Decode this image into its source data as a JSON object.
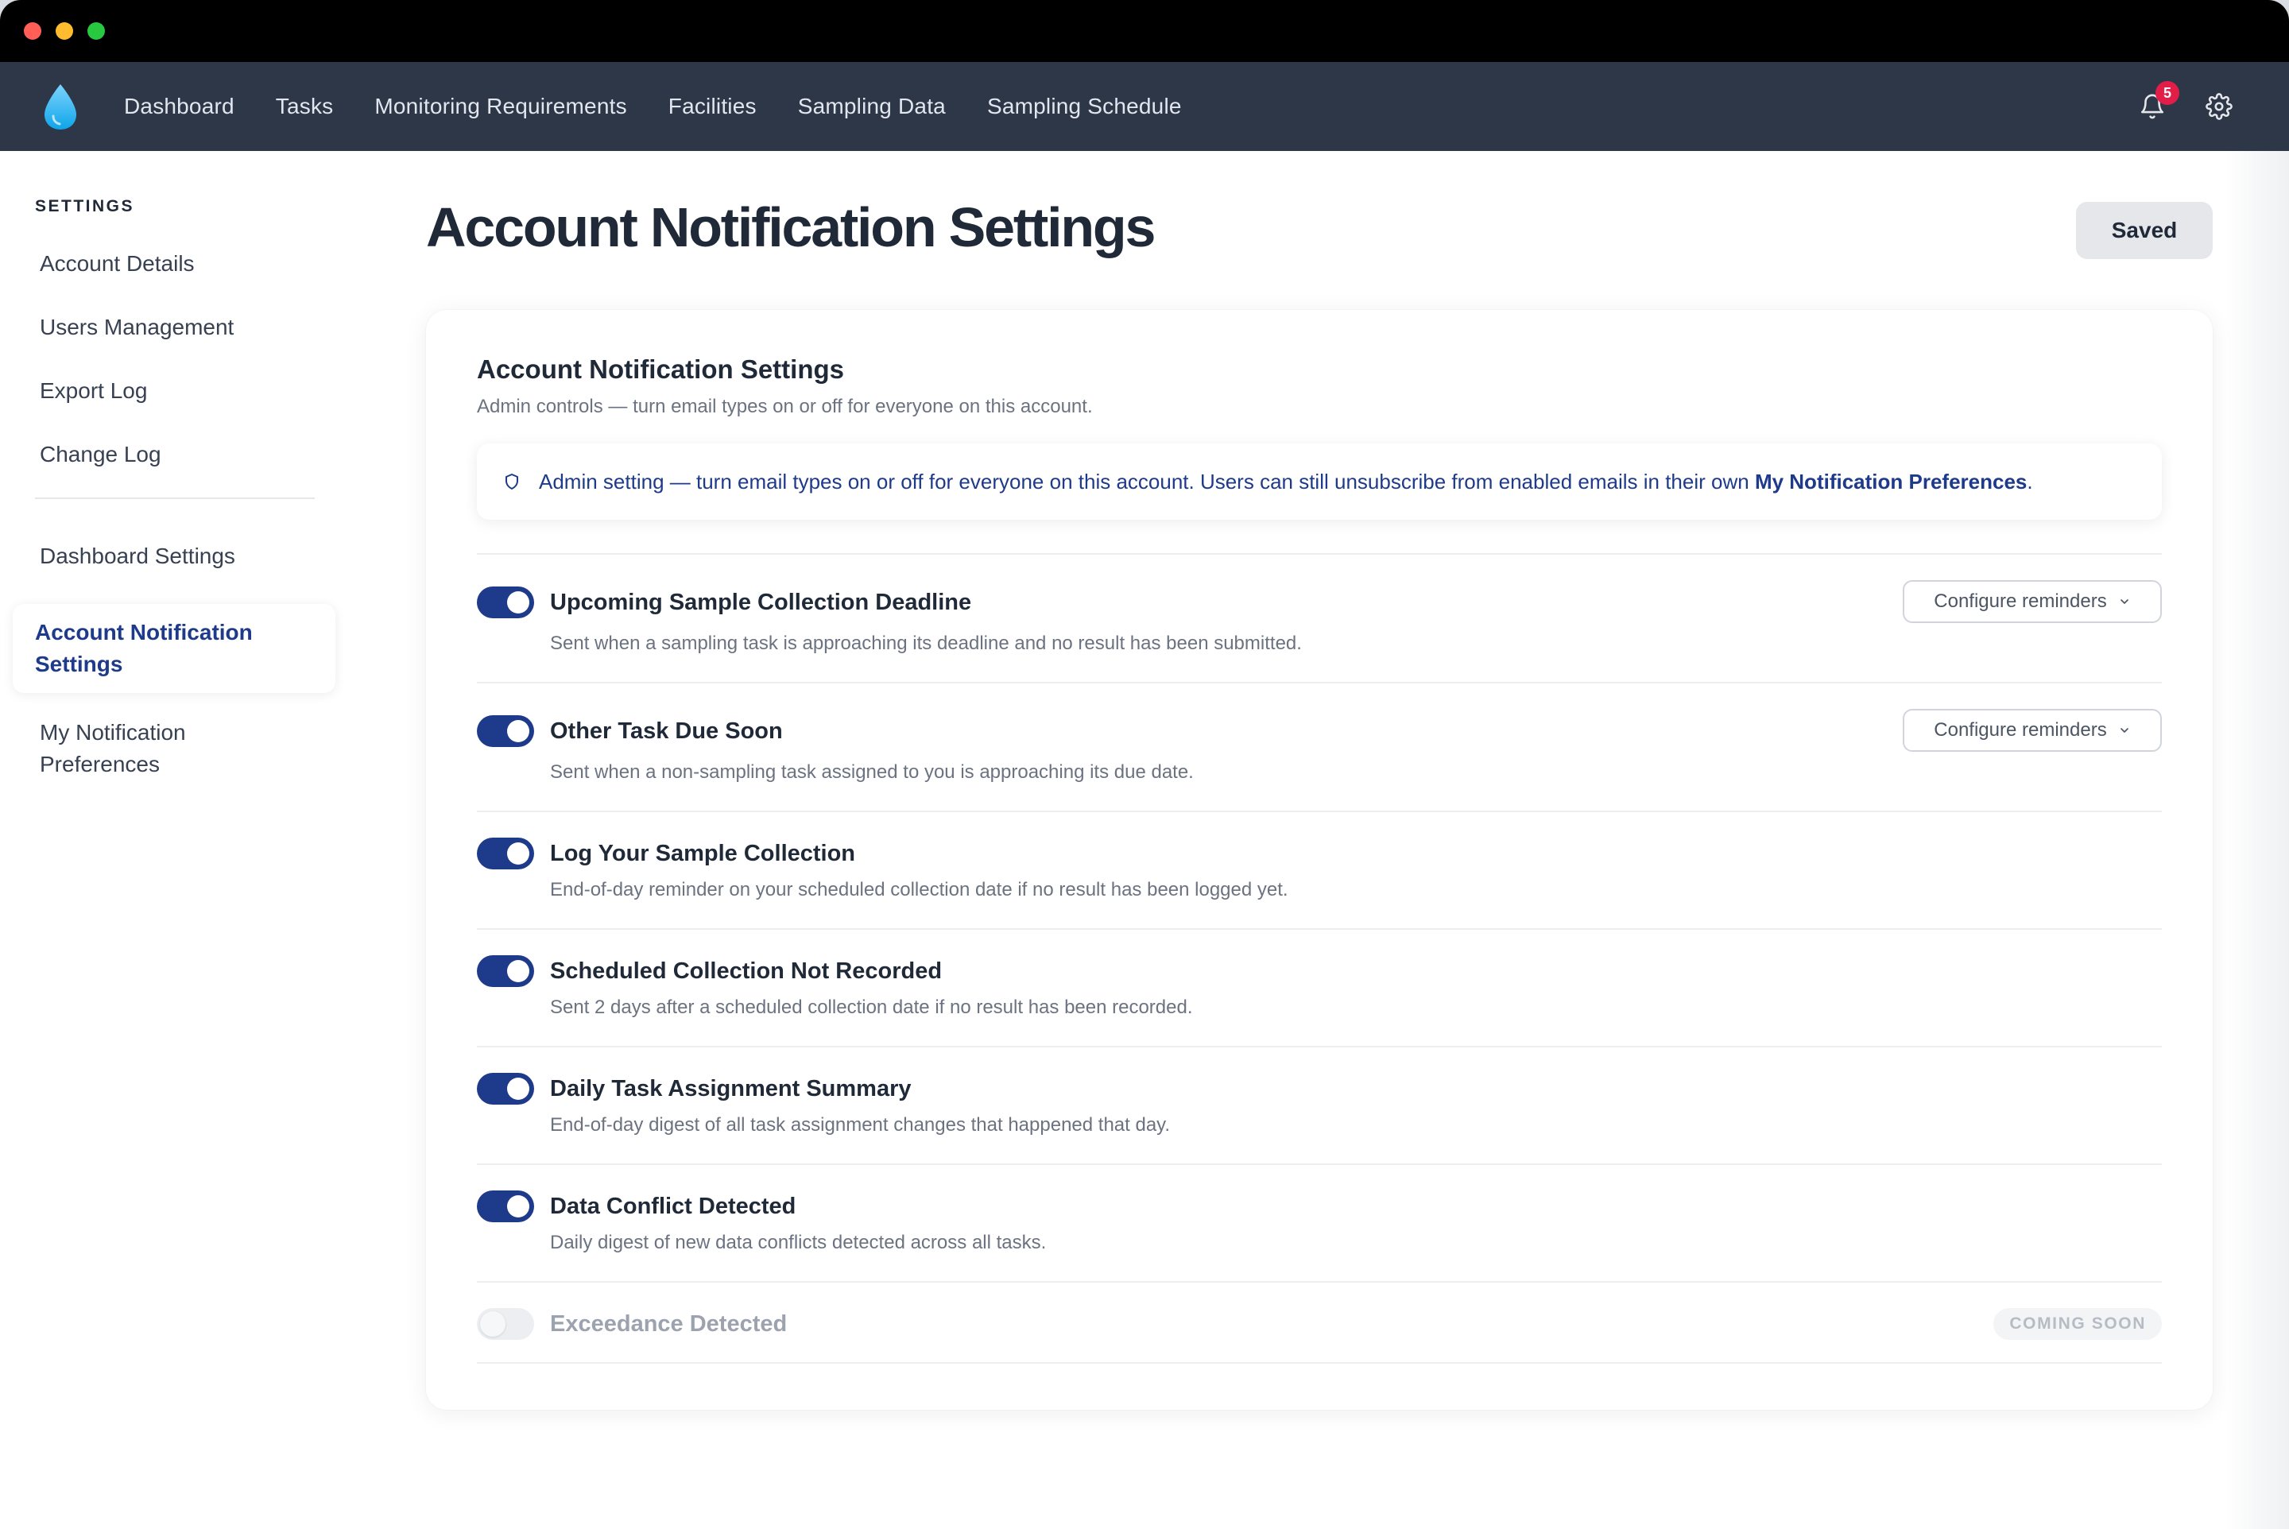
{
  "nav": {
    "items": [
      "Dashboard",
      "Tasks",
      "Monitoring Requirements",
      "Facilities",
      "Sampling Data",
      "Sampling Schedule"
    ],
    "notification_count": "5"
  },
  "sidebar": {
    "heading": "SETTINGS",
    "group1": [
      "Account Details",
      "Users Management",
      "Export Log",
      "Change Log"
    ],
    "dashboard_settings": "Dashboard Settings",
    "active": "Account Notification Settings",
    "my_prefs": "My Notification Preferences"
  },
  "page": {
    "title": "Account Notification Settings",
    "saved_label": "Saved"
  },
  "card": {
    "title": "Account Notification Settings",
    "subtitle": "Admin controls — turn email types on or off for everyone on this account.",
    "info_text": "Admin setting — turn email types on or off for everyone on this account. Users can still unsubscribe from enabled emails in their own",
    "info_link": "My Notification Preferences",
    "info_end": "."
  },
  "configure_label": "Configure reminders",
  "coming_soon_label": "COMING SOON",
  "notifications": [
    {
      "title": "Upcoming Sample Collection Deadline",
      "desc": "Sent when a sampling task is approaching its deadline and no result has been submitted.",
      "enabled": true,
      "configurable": true
    },
    {
      "title": "Other Task Due Soon",
      "desc": "Sent when a non-sampling task assigned to you is approaching its due date.",
      "enabled": true,
      "configurable": true
    },
    {
      "title": "Log Your Sample Collection",
      "desc": "End-of-day reminder on your scheduled collection date if no result has been logged yet.",
      "enabled": true,
      "configurable": false
    },
    {
      "title": "Scheduled Collection Not Recorded",
      "desc": "Sent 2 days after a scheduled collection date if no result has been recorded.",
      "enabled": true,
      "configurable": false
    },
    {
      "title": "Daily Task Assignment Summary",
      "desc": "End-of-day digest of all task assignment changes that happened that day.",
      "enabled": true,
      "configurable": false
    },
    {
      "title": "Data Conflict Detected",
      "desc": "Daily digest of new data conflicts detected across all tasks.",
      "enabled": true,
      "configurable": false
    },
    {
      "title": "Exceedance Detected",
      "desc": "",
      "enabled": false,
      "configurable": false,
      "coming_soon": true
    }
  ],
  "colors": {
    "nav_bg": "#2d3748",
    "accent": "#1e3a8a",
    "logo_drop": "#38bdf8",
    "badge": "#e11d48"
  },
  "icons": {
    "logo": "water-drop-icon",
    "bell": "bell-icon",
    "settings": "gear-icon",
    "shield": "shield-icon",
    "chevron": "chevron-down-icon"
  }
}
